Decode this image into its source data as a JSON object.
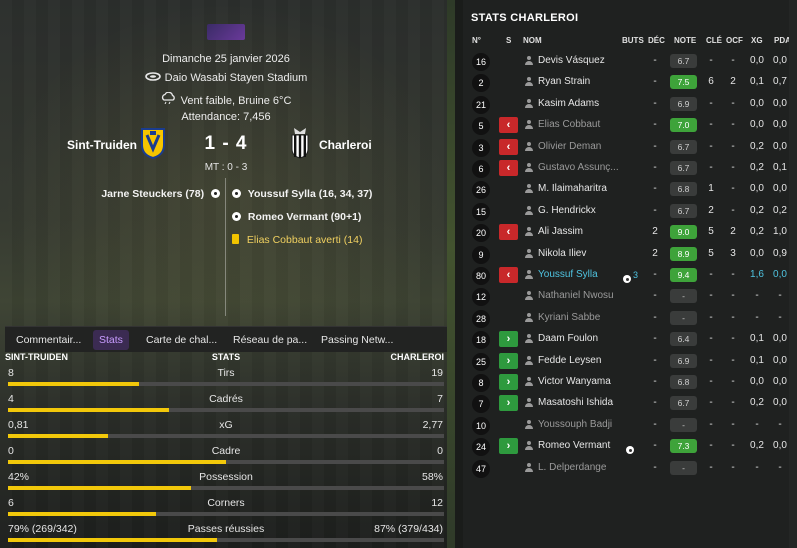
{
  "match": {
    "date": "Dimanche 25 janvier 2026",
    "stadium": "Daio Wasabi Stayen Stadium",
    "weather": "Vent faible, Bruine 6°C",
    "attendance": "Attendance: 7,456",
    "home_team": "Sint-Truiden",
    "away_team": "Charleroi",
    "score": "1 - 4",
    "halftime": "MT : 0 - 3",
    "home_events": [
      {
        "text": "Jarne Steuckers (78)",
        "type": "goal"
      }
    ],
    "away_events": [
      {
        "text": "Youssuf Sylla (16, 34, 37)",
        "type": "goal"
      },
      {
        "text": "Romeo Vermant (90+1)",
        "type": "goal"
      },
      {
        "text": "Elias Cobbaut averti (14)",
        "type": "yellow"
      }
    ]
  },
  "tabs": [
    {
      "label": "Commentair...",
      "active": false
    },
    {
      "label": "Stats",
      "active": true
    },
    {
      "label": "Carte de chal...",
      "active": false
    },
    {
      "label": "Réseau de pa...",
      "active": false
    },
    {
      "label": "Passing Netw...",
      "active": false
    }
  ],
  "stats_header": {
    "home": "SINT-TRUIDEN",
    "title": "STATS",
    "away": "CHARLEROI"
  },
  "stats": [
    {
      "label": "Tirs",
      "home": "8",
      "away": "19",
      "home_share": 0.3
    },
    {
      "label": "Cadrés",
      "home": "4",
      "away": "7",
      "home_share": 0.37
    },
    {
      "label": "xG",
      "home": "0,81",
      "away": "2,77",
      "home_share": 0.23
    },
    {
      "label": "Cadre",
      "home": "0",
      "away": "0",
      "home_share": 0.5
    },
    {
      "label": "Possession",
      "home": "42%",
      "away": "58%",
      "home_share": 0.42
    },
    {
      "label": "Corners",
      "home": "6",
      "away": "12",
      "home_share": 0.34
    },
    {
      "label": "Passes réussies",
      "home": "79% (269/342)",
      "away": "87% (379/434)",
      "home_share": 0.48
    }
  ],
  "player_table": {
    "title": "STATS CHARLEROI",
    "columns": [
      "N°",
      "S",
      "NOM",
      "BUTS",
      "DÉC",
      "NOTE",
      "CLÉ",
      "OCF",
      "XG",
      "PDA"
    ],
    "rows": [
      {
        "num": "16",
        "sub": "",
        "name": "Devis Vásquez",
        "style": "",
        "buts": "",
        "dec": "-",
        "note": "6.7",
        "note_style": "grey",
        "cle": "-",
        "ocf": "-",
        "xg": "0,0",
        "pda": "0,0"
      },
      {
        "num": "2",
        "sub": "",
        "name": "Ryan Strain",
        "style": "",
        "buts": "",
        "dec": "-",
        "note": "7.5",
        "note_style": "green",
        "cle": "6",
        "ocf": "2",
        "xg": "0,1",
        "pda": "0,7"
      },
      {
        "num": "21",
        "sub": "",
        "name": "Kasim Adams",
        "style": "",
        "buts": "",
        "dec": "-",
        "note": "6.9",
        "note_style": "grey",
        "cle": "-",
        "ocf": "-",
        "xg": "0,0",
        "pda": "0,0"
      },
      {
        "num": "5",
        "sub": "out",
        "name": "Elias Cobbaut",
        "style": "dim",
        "buts": "",
        "dec": "-",
        "note": "7.0",
        "note_style": "green",
        "cle": "-",
        "ocf": "-",
        "xg": "0,0",
        "pda": "0,0"
      },
      {
        "num": "3",
        "sub": "out",
        "name": "Olivier Deman",
        "style": "dim",
        "buts": "",
        "dec": "-",
        "note": "6.7",
        "note_style": "grey",
        "cle": "-",
        "ocf": "-",
        "xg": "0,2",
        "pda": "0,0"
      },
      {
        "num": "6",
        "sub": "out",
        "name": "Gustavo Assunç...",
        "style": "dim",
        "buts": "",
        "dec": "-",
        "note": "6.7",
        "note_style": "grey",
        "cle": "-",
        "ocf": "-",
        "xg": "0,2",
        "pda": "0,1"
      },
      {
        "num": "26",
        "sub": "",
        "name": "M. Ilaimaharitra",
        "style": "",
        "buts": "",
        "dec": "-",
        "note": "6.8",
        "note_style": "grey",
        "cle": "1",
        "ocf": "-",
        "xg": "0,0",
        "pda": "0,0"
      },
      {
        "num": "15",
        "sub": "",
        "name": "G. Hendrickx",
        "style": "",
        "buts": "",
        "dec": "-",
        "note": "6.7",
        "note_style": "grey",
        "cle": "2",
        "ocf": "-",
        "xg": "0,2",
        "pda": "0,2"
      },
      {
        "num": "20",
        "sub": "out",
        "name": "Ali Jassim",
        "style": "",
        "buts": "",
        "dec": "2",
        "note": "9.0",
        "note_style": "green",
        "cle": "5",
        "ocf": "2",
        "xg": "0,2",
        "pda": "1,0"
      },
      {
        "num": "9",
        "sub": "",
        "name": "Nikola Iliev",
        "style": "",
        "buts": "",
        "dec": "2",
        "note": "8.9",
        "note_style": "green",
        "cle": "5",
        "ocf": "3",
        "xg": "0,0",
        "pda": "0,9"
      },
      {
        "num": "80",
        "sub": "out",
        "name": "Youssuf Sylla",
        "style": "hl",
        "buts": "3",
        "dec": "-",
        "note": "9.4",
        "note_style": "green",
        "cle": "-",
        "ocf": "-",
        "xg": "1,6",
        "pda": "0,0"
      },
      {
        "num": "12",
        "sub": "",
        "name": "Nathaniel Nwosu",
        "style": "dim",
        "buts": "",
        "dec": "-",
        "note": "-",
        "note_style": "grey",
        "cle": "-",
        "ocf": "-",
        "xg": "-",
        "pda": "-"
      },
      {
        "num": "28",
        "sub": "",
        "name": "Kyriani Sabbe",
        "style": "dim",
        "buts": "",
        "dec": "-",
        "note": "-",
        "note_style": "grey",
        "cle": "-",
        "ocf": "-",
        "xg": "-",
        "pda": "-"
      },
      {
        "num": "18",
        "sub": "in",
        "name": "Daam Foulon",
        "style": "",
        "buts": "",
        "dec": "-",
        "note": "6.4",
        "note_style": "grey",
        "cle": "-",
        "ocf": "-",
        "xg": "0,1",
        "pda": "0,0"
      },
      {
        "num": "25",
        "sub": "in",
        "name": "Fedde Leysen",
        "style": "",
        "buts": "",
        "dec": "-",
        "note": "6.9",
        "note_style": "grey",
        "cle": "-",
        "ocf": "-",
        "xg": "0,1",
        "pda": "0,0"
      },
      {
        "num": "8",
        "sub": "in",
        "name": "Victor Wanyama",
        "style": "",
        "buts": "",
        "dec": "-",
        "note": "6.8",
        "note_style": "grey",
        "cle": "-",
        "ocf": "-",
        "xg": "0,0",
        "pda": "0,0"
      },
      {
        "num": "7",
        "sub": "in",
        "name": "Masatoshi Ishida",
        "style": "",
        "buts": "",
        "dec": "-",
        "note": "6.7",
        "note_style": "grey",
        "cle": "-",
        "ocf": "-",
        "xg": "0,2",
        "pda": "0,0"
      },
      {
        "num": "10",
        "sub": "",
        "name": "Youssouph Badji",
        "style": "dim",
        "buts": "",
        "dec": "-",
        "note": "-",
        "note_style": "grey",
        "cle": "-",
        "ocf": "-",
        "xg": "-",
        "pda": "-"
      },
      {
        "num": "24",
        "sub": "in",
        "name": "Romeo Vermant",
        "style": "",
        "buts": "goal",
        "dec": "-",
        "note": "7.3",
        "note_style": "green",
        "cle": "-",
        "ocf": "-",
        "xg": "0,2",
        "pda": "0,0"
      },
      {
        "num": "47",
        "sub": "",
        "name": "L. Delperdange",
        "style": "dim",
        "buts": "",
        "dec": "-",
        "note": "-",
        "note_style": "grey",
        "cle": "-",
        "ocf": "-",
        "xg": "-",
        "pda": "-"
      }
    ]
  },
  "colors": {
    "accent_yellow": "#f2c80a",
    "note_green": "#3ea33a",
    "sub_out": "#c8282a",
    "sub_in": "#2e9a3e",
    "highlight_blue": "#4fc3e0",
    "tab_active": "#c89cff"
  }
}
